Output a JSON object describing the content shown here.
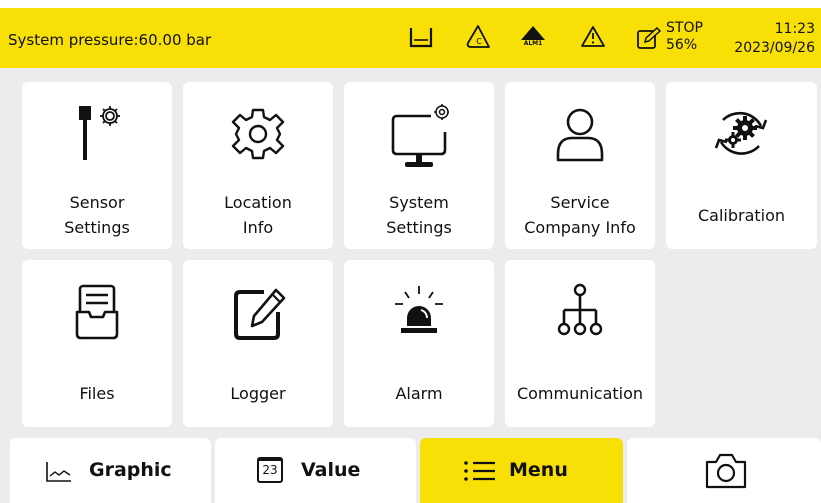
{
  "status_bar": {
    "pressure_text": "System pressure:60.00 bar",
    "alarm_code": "ALM1",
    "logger_status": "STOP",
    "logger_percent": "56%",
    "time": "11:23",
    "date": "2023/09/26",
    "icons": [
      "tank-icon",
      "cycle-c-icon",
      "alarm-triangle-icon",
      "warning-icon",
      "logger-edit-icon"
    ],
    "accent_color": "#f8df06"
  },
  "menu": {
    "tiles": [
      {
        "line1": "Sensor",
        "line2": "Settings",
        "icon": "sensor-settings-icon"
      },
      {
        "line1": "Location",
        "line2": "Info",
        "icon": "gear-icon"
      },
      {
        "line1": "System",
        "line2": "Settings",
        "icon": "monitor-settings-icon"
      },
      {
        "line1": "Service",
        "line2": "Company Info",
        "icon": "person-icon"
      },
      {
        "line1": "Calibration",
        "line2": "",
        "icon": "calibration-icon"
      },
      {
        "line1": "Files",
        "line2": "",
        "icon": "file-tray-icon"
      },
      {
        "line1": "Logger",
        "line2": "",
        "icon": "edit-icon"
      },
      {
        "line1": "Alarm",
        "line2": "",
        "icon": "siren-icon"
      },
      {
        "line1": "Communication",
        "line2": "",
        "icon": "network-icon"
      }
    ]
  },
  "bottom_nav": {
    "graphic": "Graphic",
    "value": "Value",
    "value_icon_text": "23",
    "menu": "Menu",
    "active": "Menu"
  }
}
